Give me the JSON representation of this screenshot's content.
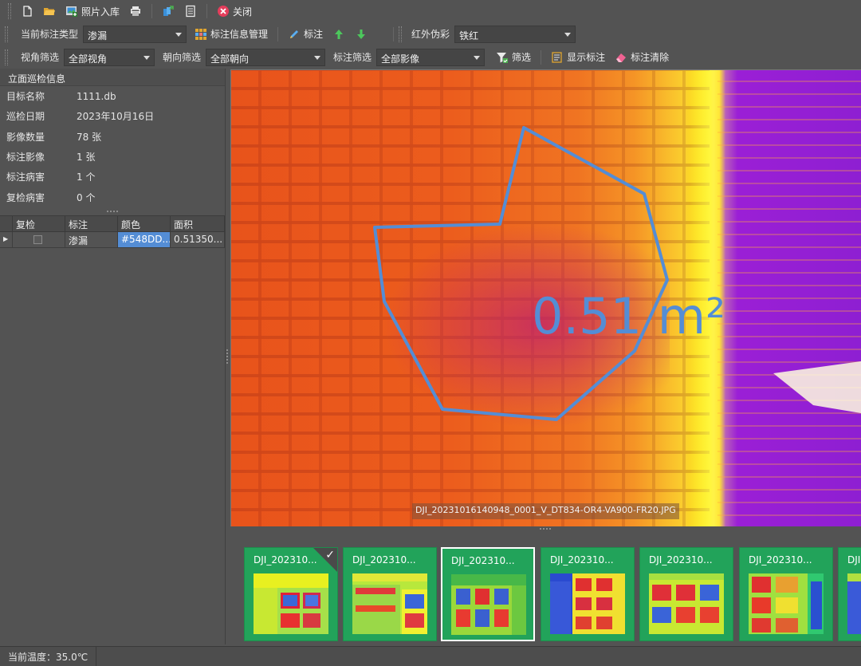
{
  "toolbar1": {
    "photo_import": "照片入库",
    "close": "关闭"
  },
  "toolbar2": {
    "annotation_type_label": "当前标注类型",
    "annotation_type_value": "渗漏",
    "info_manage": "标注信息管理",
    "annotate": "标注",
    "palette_label": "红外伪彩",
    "palette_value": "铁红"
  },
  "toolbar3": {
    "angle_filter_label": "视角筛选",
    "angle_filter_value": "全部视角",
    "orientation_filter_label": "朝向筛选",
    "orientation_filter_value": "全部朝向",
    "annotation_filter_label": "标注筛选",
    "annotation_filter_value": "全部影像",
    "filter": "筛选",
    "show_annotations": "显示标注",
    "clear_annotations": "标注清除"
  },
  "info_panel": {
    "title": "立面巡检信息",
    "rows": [
      {
        "key": "目标名称",
        "value": "1111.db"
      },
      {
        "key": "巡检日期",
        "value": "2023年10月16日"
      },
      {
        "key": "影像数量",
        "value": "78 张"
      },
      {
        "key": "标注影像",
        "value": "1 张"
      },
      {
        "key": "标注病害",
        "value": "1 个"
      },
      {
        "key": "复检病害",
        "value": "0 个"
      }
    ]
  },
  "grid": {
    "headers": [
      "复检",
      "标注",
      "颜色",
      "面积"
    ],
    "rows": [
      {
        "label": "渗漏",
        "color": "#548DD...",
        "area": "0.51350..."
      }
    ]
  },
  "image": {
    "measurement": "0.51 m²",
    "filename": "DJI_20231016140948_0001_V_DT834-OR4-VA900-FR20.JPG",
    "annotation_color": "#548DD5"
  },
  "thumbnails": [
    {
      "name": "DJI_202310...",
      "checked": true
    },
    {
      "name": "DJI_202310...",
      "checked": false
    },
    {
      "name": "DJI_202310...",
      "checked": false
    },
    {
      "name": "DJI_202310...",
      "checked": false
    },
    {
      "name": "DJI_202310...",
      "checked": false
    },
    {
      "name": "DJI_202310...",
      "checked": false
    },
    {
      "name": "DJI",
      "checked": false
    }
  ],
  "status": {
    "temperature": "当前温度：35.0℃"
  }
}
